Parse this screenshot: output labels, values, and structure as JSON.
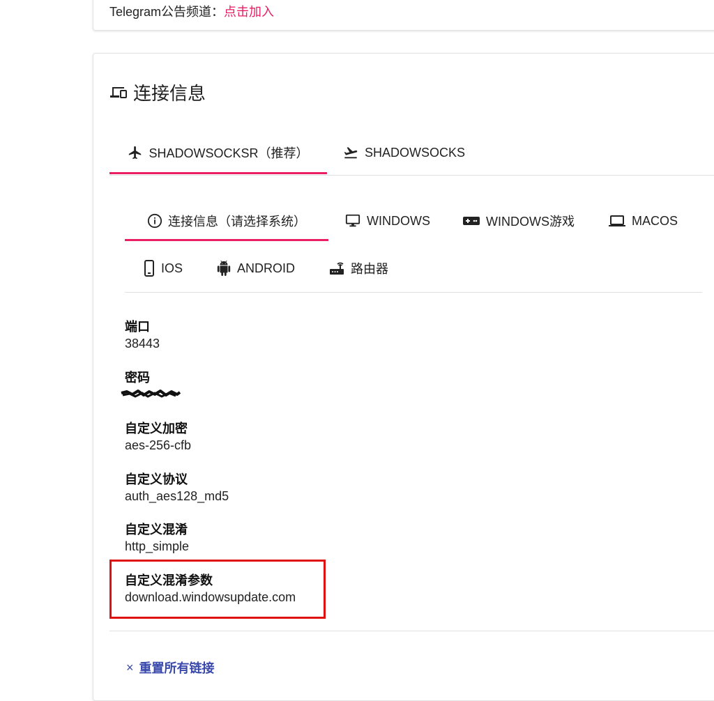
{
  "top_notice": {
    "prefix": "Telegram公告频道：",
    "link": "点击加入"
  },
  "section_title": "连接信息",
  "protocol_tabs": [
    {
      "label": "SHADOWSOCKSR（推荐）",
      "icon": "airplane-icon",
      "active": true
    },
    {
      "label": "SHADOWSOCKS",
      "icon": "flight-takeoff-icon",
      "active": false
    }
  ],
  "system_tabs": [
    {
      "label": "连接信息（请选择系统）",
      "icon": "info-icon",
      "active": true
    },
    {
      "label": "WINDOWS",
      "icon": "desktop-icon",
      "active": false
    },
    {
      "label": "WINDOWS游戏",
      "icon": "gamepad-icon",
      "active": false
    },
    {
      "label": "MACOS",
      "icon": "laptop-icon",
      "active": false
    },
    {
      "label": "IOS",
      "icon": "phone-icon",
      "active": false
    },
    {
      "label": "ANDROID",
      "icon": "android-icon",
      "active": false
    },
    {
      "label": "路由器",
      "icon": "router-icon",
      "active": false
    }
  ],
  "fields": [
    {
      "label": "端口",
      "value": "38443"
    },
    {
      "label": "密码",
      "value": ""
    },
    {
      "label": "自定义加密",
      "value": "aes-256-cfb"
    },
    {
      "label": "自定义协议",
      "value": "auth_aes128_md5"
    },
    {
      "label": "自定义混淆",
      "value": "http_simple"
    },
    {
      "label": "自定义混淆参数",
      "value": "download.windowsupdate.com"
    }
  ],
  "reset_button": {
    "icon": "×",
    "label": "重置所有链接"
  },
  "colors": {
    "accent": "#e91e63",
    "link_blue": "#3949ab",
    "highlight_red": "#e01010"
  }
}
